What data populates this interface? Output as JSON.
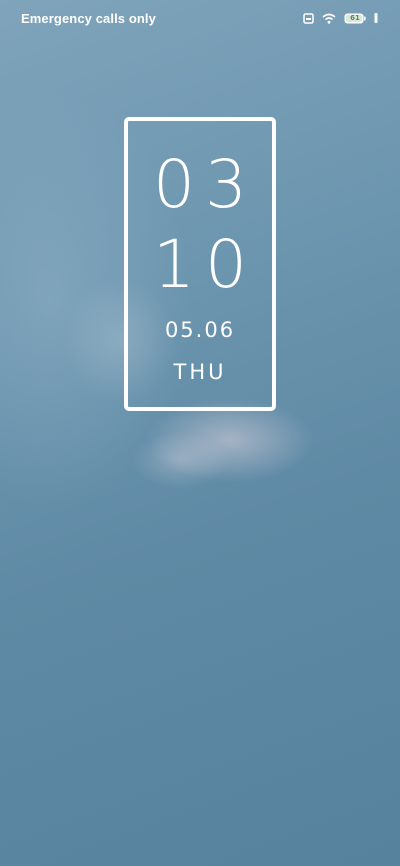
{
  "status_bar": {
    "carrier_text": "Emergency calls only",
    "battery_level": "61",
    "icons": [
      "sim-card-icon",
      "wifi-icon",
      "battery-icon",
      "charging-icon"
    ]
  },
  "clock": {
    "hours": "03",
    "minutes": "10",
    "date": "05.06",
    "weekday": "THU"
  },
  "colors": {
    "background_top": "#7fa4bb",
    "background_bottom": "#56829e",
    "text": "#ffffff"
  }
}
